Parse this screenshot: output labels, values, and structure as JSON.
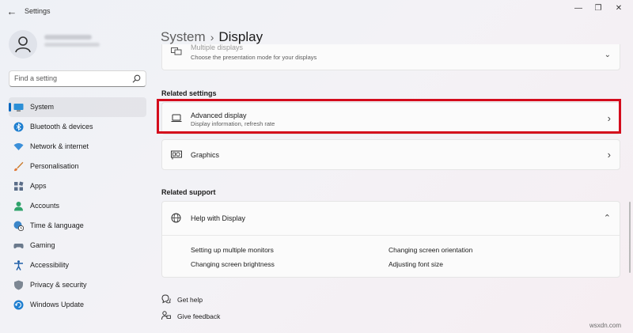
{
  "window": {
    "app_title": "Settings",
    "back_glyph": "←",
    "minimize_glyph": "—",
    "maximize_glyph": "❐",
    "close_glyph": "✕"
  },
  "search": {
    "placeholder": "Find a setting"
  },
  "sidebar": {
    "items": [
      {
        "label": "System",
        "icon": "monitor-icon",
        "active": true
      },
      {
        "label": "Bluetooth & devices",
        "icon": "bluetooth-icon"
      },
      {
        "label": "Network & internet",
        "icon": "wifi-icon"
      },
      {
        "label": "Personalisation",
        "icon": "brush-icon"
      },
      {
        "label": "Apps",
        "icon": "apps-icon"
      },
      {
        "label": "Accounts",
        "icon": "person-icon"
      },
      {
        "label": "Time & language",
        "icon": "globe-clock-icon"
      },
      {
        "label": "Gaming",
        "icon": "gamepad-icon"
      },
      {
        "label": "Accessibility",
        "icon": "accessibility-icon"
      },
      {
        "label": "Privacy & security",
        "icon": "shield-icon"
      },
      {
        "label": "Windows Update",
        "icon": "update-icon"
      }
    ]
  },
  "breadcrumb": {
    "parent": "System",
    "separator": "›",
    "current": "Display"
  },
  "multiple_displays": {
    "title": "Multiple displays",
    "subtitle": "Choose the presentation mode for your displays",
    "chevron": "⌄"
  },
  "related_settings": {
    "heading": "Related settings",
    "advanced_display": {
      "title": "Advanced display",
      "subtitle": "Display information, refresh rate",
      "chevron": "›"
    },
    "graphics": {
      "title": "Graphics",
      "chevron": "›"
    }
  },
  "related_support": {
    "heading": "Related support",
    "help_title": "Help with Display",
    "chevron": "⌃",
    "links": [
      "Setting up multiple monitors",
      "Changing screen orientation",
      "Changing screen brightness",
      "Adjusting font size"
    ]
  },
  "footer": {
    "get_help": "Get help",
    "give_feedback": "Give feedback"
  },
  "watermark": "wsxdn.com",
  "colors": {
    "accent": "#0067c0",
    "highlight_box": "#d40c1c"
  }
}
